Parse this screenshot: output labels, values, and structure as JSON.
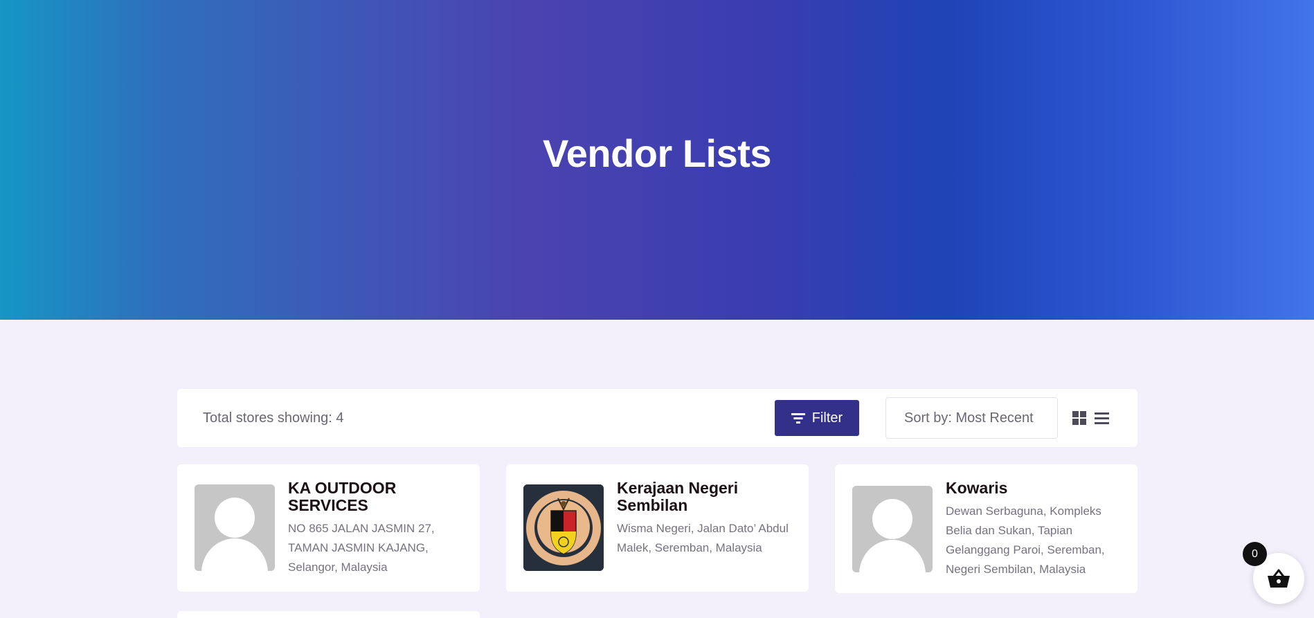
{
  "hero": {
    "title": "Vendor Lists"
  },
  "toolbar": {
    "total_label": "Total stores showing: 4",
    "filter_label": "Filter",
    "sort_label": "Sort by: Most Recent"
  },
  "stores": [
    {
      "name": "KA OUTDOOR SERVICES",
      "address": "NO 865 JALAN JASMIN 27, TAMAN JASMIN KAJANG, Selangor, Malaysia",
      "logo": "default-avatar"
    },
    {
      "name": "Kerajaan Negeri Sembilan",
      "address": "Wisma Negeri, Jalan Dato’ Abdul Malek, Seremban, Malaysia",
      "logo": "state-crest"
    },
    {
      "name": "Kowaris",
      "address": "Dewan Serbaguna, Kompleks Belia dan Sukan, Tapian Gelanggang Paroi, Seremban, Negeri Sembilan, Malaysia",
      "logo": "default-avatar"
    }
  ],
  "cart": {
    "count": "0"
  },
  "colors": {
    "accent": "#33308a",
    "page_bg": "#f3f0fb"
  }
}
